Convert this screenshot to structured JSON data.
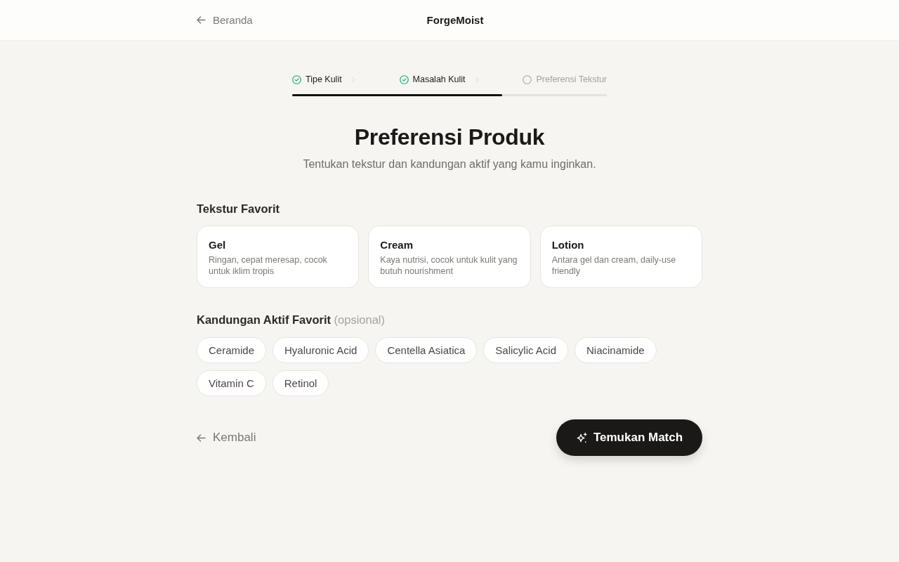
{
  "header": {
    "back_link": "Beranda",
    "brand": "ForgeMoist"
  },
  "steps": [
    {
      "label": "Tipe Kulit",
      "completed": true
    },
    {
      "label": "Masalah Kulit",
      "completed": true
    },
    {
      "label": "Preferensi Tekstur",
      "completed": false
    }
  ],
  "progress": {
    "level": 0.667
  },
  "title": "Preferensi Produk",
  "subtitle": "Tentukan tekstur dan kandungan aktif yang kamu inginkan.",
  "texture_section": {
    "label": "Tekstur Favorit",
    "options": [
      {
        "name": "Gel",
        "description": "Ringan, cepat meresap, cocok untuk iklim tropis",
        "selected": false
      },
      {
        "name": "Cream",
        "description": "Kaya nutrisi, cocok untuk kulit yang butuh nourishment",
        "selected": false
      },
      {
        "name": "Lotion",
        "description": "Antara gel dan cream, daily-use friendly",
        "selected": false
      }
    ]
  },
  "actives_section": {
    "label": "Kandungan Aktif Favorit",
    "note": "(opsional)",
    "options": [
      {
        "label": "Ceramide",
        "selected": false
      },
      {
        "label": "Hyaluronic Acid",
        "selected": false
      },
      {
        "label": "Centella Asiatica",
        "selected": false
      },
      {
        "label": "Salicylic Acid",
        "selected": false
      },
      {
        "label": "Niacinamide",
        "selected": false
      },
      {
        "label": "Vitamin C",
        "selected": false
      },
      {
        "label": "Retinol",
        "selected": false
      }
    ]
  },
  "footer": {
    "back_button": "Kembali",
    "submit_button": "Temukan Match"
  }
}
